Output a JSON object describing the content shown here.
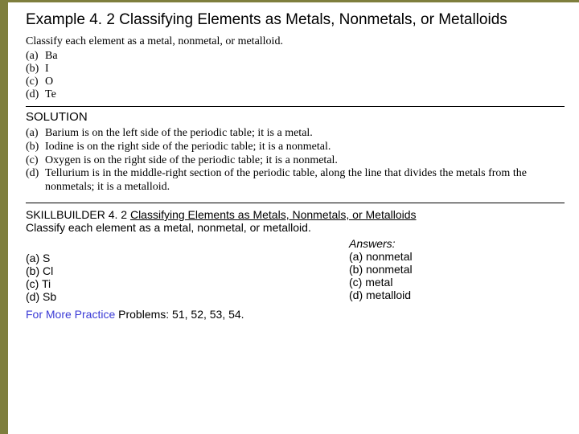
{
  "title": {
    "prefix": "Example 4. 2",
    "rest": " Classifying Elements as Metals, Nonmetals, or Metalloids"
  },
  "prompt": "Classify each element as a metal, nonmetal, or metalloid.",
  "items": {
    "a": {
      "label": "(a)",
      "value": "Ba"
    },
    "b": {
      "label": "(b)",
      "value": "I"
    },
    "c": {
      "label": "(c)",
      "value": "O"
    },
    "d": {
      "label": "(d)",
      "value": "Te"
    }
  },
  "solution_head": "SOLUTION",
  "solutions": {
    "a": {
      "label": "(a)",
      "text": "Barium is on the left side of the periodic table; it is a metal."
    },
    "b": {
      "label": "(b)",
      "text": "Iodine is on the right side of the periodic table; it is a nonmetal."
    },
    "c": {
      "label": "(c)",
      "text": "Oxygen is on the right side of the periodic table; it is a nonmetal."
    },
    "d": {
      "label": "(d)",
      "text": "Tellurium is in the middle-right section of the periodic table, along the line that divides the metals from the nonmetals; it is a metalloid."
    }
  },
  "skill": {
    "head": "SKILLBUILDER 4. 2   ",
    "title_underline": "Classifying Elements as Metals, Nonmetals, or Metalloids",
    "prompt": "Classify each element as a metal, nonmetal, or metalloid.",
    "items": {
      "a": "(a) S",
      "b": "(b) Cl",
      "c": "(c) Ti",
      "d": "(d) Sb"
    },
    "answers_head": "Answers:",
    "answers": {
      "a": "(a) nonmetal",
      "b": "(b) nonmetal",
      "c": "(c) metal",
      "d": "(d) metalloid"
    }
  },
  "more": {
    "lead": "For More Practice ",
    "rest": "Problems: 51, 52, 53, 54."
  }
}
